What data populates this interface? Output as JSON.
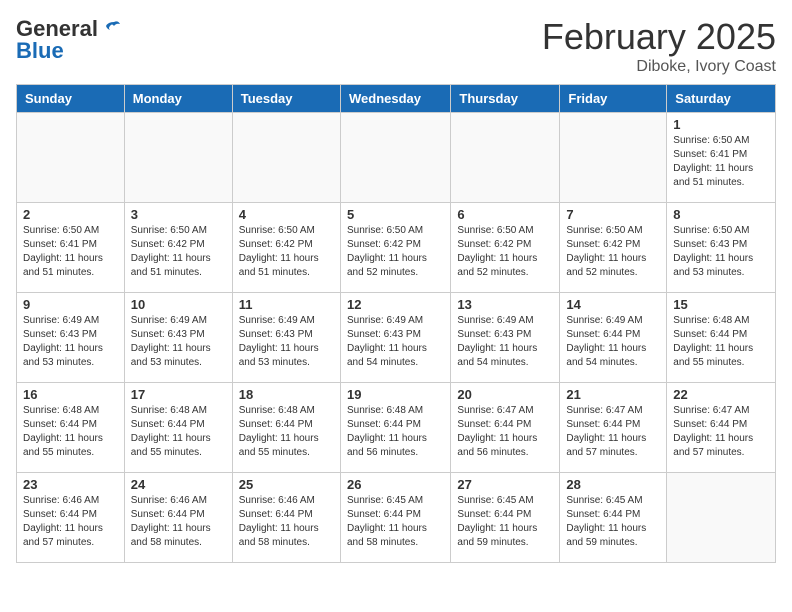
{
  "header": {
    "logo_general": "General",
    "logo_blue": "Blue",
    "month_title": "February 2025",
    "subtitle": "Diboke, Ivory Coast"
  },
  "days_of_week": [
    "Sunday",
    "Monday",
    "Tuesday",
    "Wednesday",
    "Thursday",
    "Friday",
    "Saturday"
  ],
  "weeks": [
    [
      {
        "day": "",
        "info": ""
      },
      {
        "day": "",
        "info": ""
      },
      {
        "day": "",
        "info": ""
      },
      {
        "day": "",
        "info": ""
      },
      {
        "day": "",
        "info": ""
      },
      {
        "day": "",
        "info": ""
      },
      {
        "day": "1",
        "info": "Sunrise: 6:50 AM\nSunset: 6:41 PM\nDaylight: 11 hours and 51 minutes."
      }
    ],
    [
      {
        "day": "2",
        "info": "Sunrise: 6:50 AM\nSunset: 6:41 PM\nDaylight: 11 hours and 51 minutes."
      },
      {
        "day": "3",
        "info": "Sunrise: 6:50 AM\nSunset: 6:42 PM\nDaylight: 11 hours and 51 minutes."
      },
      {
        "day": "4",
        "info": "Sunrise: 6:50 AM\nSunset: 6:42 PM\nDaylight: 11 hours and 51 minutes."
      },
      {
        "day": "5",
        "info": "Sunrise: 6:50 AM\nSunset: 6:42 PM\nDaylight: 11 hours and 52 minutes."
      },
      {
        "day": "6",
        "info": "Sunrise: 6:50 AM\nSunset: 6:42 PM\nDaylight: 11 hours and 52 minutes."
      },
      {
        "day": "7",
        "info": "Sunrise: 6:50 AM\nSunset: 6:42 PM\nDaylight: 11 hours and 52 minutes."
      },
      {
        "day": "8",
        "info": "Sunrise: 6:50 AM\nSunset: 6:43 PM\nDaylight: 11 hours and 53 minutes."
      }
    ],
    [
      {
        "day": "9",
        "info": "Sunrise: 6:49 AM\nSunset: 6:43 PM\nDaylight: 11 hours and 53 minutes."
      },
      {
        "day": "10",
        "info": "Sunrise: 6:49 AM\nSunset: 6:43 PM\nDaylight: 11 hours and 53 minutes."
      },
      {
        "day": "11",
        "info": "Sunrise: 6:49 AM\nSunset: 6:43 PM\nDaylight: 11 hours and 53 minutes."
      },
      {
        "day": "12",
        "info": "Sunrise: 6:49 AM\nSunset: 6:43 PM\nDaylight: 11 hours and 54 minutes."
      },
      {
        "day": "13",
        "info": "Sunrise: 6:49 AM\nSunset: 6:43 PM\nDaylight: 11 hours and 54 minutes."
      },
      {
        "day": "14",
        "info": "Sunrise: 6:49 AM\nSunset: 6:44 PM\nDaylight: 11 hours and 54 minutes."
      },
      {
        "day": "15",
        "info": "Sunrise: 6:48 AM\nSunset: 6:44 PM\nDaylight: 11 hours and 55 minutes."
      }
    ],
    [
      {
        "day": "16",
        "info": "Sunrise: 6:48 AM\nSunset: 6:44 PM\nDaylight: 11 hours and 55 minutes."
      },
      {
        "day": "17",
        "info": "Sunrise: 6:48 AM\nSunset: 6:44 PM\nDaylight: 11 hours and 55 minutes."
      },
      {
        "day": "18",
        "info": "Sunrise: 6:48 AM\nSunset: 6:44 PM\nDaylight: 11 hours and 55 minutes."
      },
      {
        "day": "19",
        "info": "Sunrise: 6:48 AM\nSunset: 6:44 PM\nDaylight: 11 hours and 56 minutes."
      },
      {
        "day": "20",
        "info": "Sunrise: 6:47 AM\nSunset: 6:44 PM\nDaylight: 11 hours and 56 minutes."
      },
      {
        "day": "21",
        "info": "Sunrise: 6:47 AM\nSunset: 6:44 PM\nDaylight: 11 hours and 57 minutes."
      },
      {
        "day": "22",
        "info": "Sunrise: 6:47 AM\nSunset: 6:44 PM\nDaylight: 11 hours and 57 minutes."
      }
    ],
    [
      {
        "day": "23",
        "info": "Sunrise: 6:46 AM\nSunset: 6:44 PM\nDaylight: 11 hours and 57 minutes."
      },
      {
        "day": "24",
        "info": "Sunrise: 6:46 AM\nSunset: 6:44 PM\nDaylight: 11 hours and 58 minutes."
      },
      {
        "day": "25",
        "info": "Sunrise: 6:46 AM\nSunset: 6:44 PM\nDaylight: 11 hours and 58 minutes."
      },
      {
        "day": "26",
        "info": "Sunrise: 6:45 AM\nSunset: 6:44 PM\nDaylight: 11 hours and 58 minutes."
      },
      {
        "day": "27",
        "info": "Sunrise: 6:45 AM\nSunset: 6:44 PM\nDaylight: 11 hours and 59 minutes."
      },
      {
        "day": "28",
        "info": "Sunrise: 6:45 AM\nSunset: 6:44 PM\nDaylight: 11 hours and 59 minutes."
      },
      {
        "day": "",
        "info": ""
      }
    ]
  ]
}
